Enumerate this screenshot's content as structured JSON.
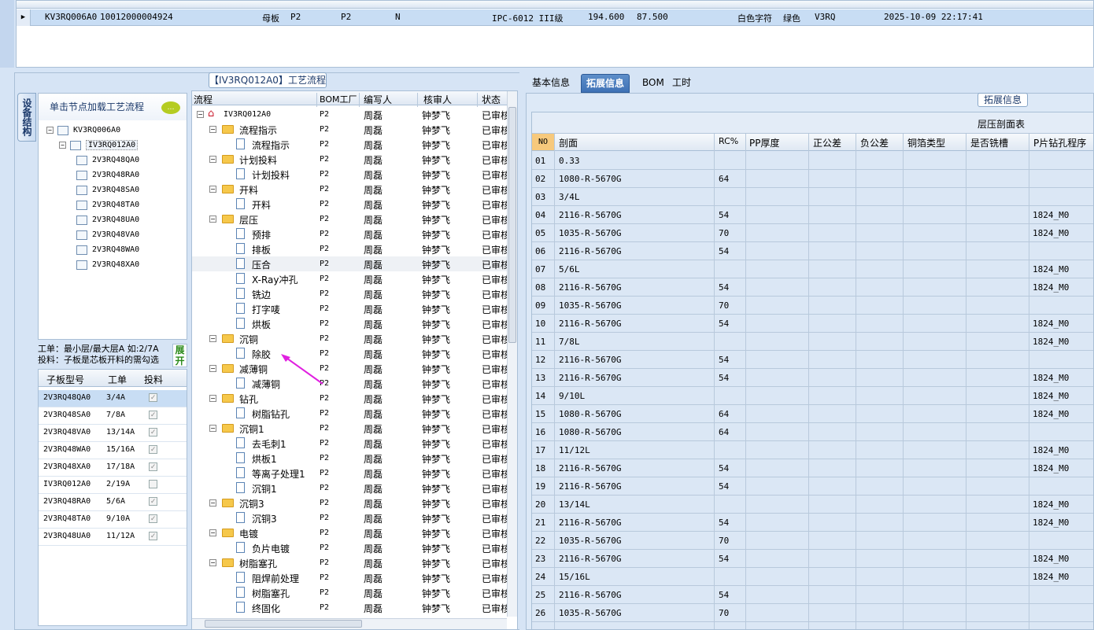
{
  "top_grid": {
    "row": [
      "KV3RQ006A0",
      "10012000004924",
      "母板",
      "P2",
      "P2",
      "N",
      "IPC-6012 III级",
      "194.600",
      "87.500",
      "白色字符",
      "绿色",
      "V3RQ",
      "2025-10-09 22:17:41"
    ]
  },
  "left_panel": {
    "title": "【IV3RQ012A0】工艺流程",
    "side_tab": "设备结构",
    "tree_hint": "单击节点加载工艺流程",
    "tree": {
      "root": "KV3RQ006A0",
      "child": "IV3RQ012A0",
      "leaves": [
        "2V3RQ48QA0",
        "2V3RQ48RA0",
        "2V3RQ48SA0",
        "2V3RQ48TA0",
        "2V3RQ48UA0",
        "2V3RQ48VA0",
        "2V3RQ48WA0",
        "2V3RQ48XA0"
      ]
    },
    "work_info_1": "工单：最小层/最大层A 如:2/7A",
    "work_info_2": "投料：子板是芯板开料的需勾选",
    "expand_label": "展开",
    "sub_grid": {
      "headers": [
        "子板型号",
        "工单",
        "投料"
      ],
      "rows": [
        {
          "model": "2V3RQ48QA0",
          "order": "3/4A",
          "checked": true
        },
        {
          "model": "2V3RQ48SA0",
          "order": "7/8A",
          "checked": true
        },
        {
          "model": "2V3RQ48VA0",
          "order": "13/14A",
          "checked": true
        },
        {
          "model": "2V3RQ48WA0",
          "order": "15/16A",
          "checked": true
        },
        {
          "model": "2V3RQ48XA0",
          "order": "17/18A",
          "checked": true
        },
        {
          "model": "IV3RQ012A0",
          "order": "2/19A",
          "checked": false
        },
        {
          "model": "2V3RQ48RA0",
          "order": "5/6A",
          "checked": true
        },
        {
          "model": "2V3RQ48TA0",
          "order": "9/10A",
          "checked": true
        },
        {
          "model": "2V3RQ48UA0",
          "order": "11/12A",
          "checked": true
        }
      ]
    }
  },
  "process_tree": {
    "headers": [
      "流程",
      "BOM工厂",
      "编写人",
      "核审人",
      "状态"
    ],
    "root": "IV3RQ012A0",
    "bom": "P2",
    "writer": "周磊",
    "reviewer": "钟梦飞",
    "status": "已审核",
    "rows": [
      {
        "label": "流程指示",
        "type": "folder"
      },
      {
        "label": "流程指示",
        "type": "doc"
      },
      {
        "label": "计划投料",
        "type": "folder"
      },
      {
        "label": "计划投料",
        "type": "doc"
      },
      {
        "label": "开料",
        "type": "folder"
      },
      {
        "label": "开料",
        "type": "doc"
      },
      {
        "label": "层压",
        "type": "folder"
      },
      {
        "label": "预排",
        "type": "doc"
      },
      {
        "label": "排板",
        "type": "doc"
      },
      {
        "label": "压合",
        "type": "doc"
      },
      {
        "label": "X-Ray冲孔",
        "type": "doc"
      },
      {
        "label": "铣边",
        "type": "doc"
      },
      {
        "label": "打字唛",
        "type": "doc"
      },
      {
        "label": "烘板",
        "type": "doc"
      },
      {
        "label": "沉铜",
        "type": "folder"
      },
      {
        "label": "除胶",
        "type": "doc"
      },
      {
        "label": "减薄铜",
        "type": "folder"
      },
      {
        "label": "减薄铜",
        "type": "doc"
      },
      {
        "label": "钻孔",
        "type": "folder"
      },
      {
        "label": "树脂钻孔",
        "type": "doc"
      },
      {
        "label": "沉铜1",
        "type": "folder"
      },
      {
        "label": "去毛刺1",
        "type": "doc"
      },
      {
        "label": "烘板1",
        "type": "doc"
      },
      {
        "label": "等离子处理1",
        "type": "doc"
      },
      {
        "label": "沉铜1",
        "type": "doc"
      },
      {
        "label": "沉铜3",
        "type": "folder"
      },
      {
        "label": "沉铜3",
        "type": "doc"
      },
      {
        "label": "电镀",
        "type": "folder"
      },
      {
        "label": "负片电镀",
        "type": "doc"
      },
      {
        "label": "树脂塞孔",
        "type": "folder"
      },
      {
        "label": "阻焊前处理",
        "type": "doc"
      },
      {
        "label": "树脂塞孔",
        "type": "doc"
      },
      {
        "label": "终固化",
        "type": "doc"
      }
    ]
  },
  "right_panel": {
    "tabs": [
      "基本信息",
      "拓展信息",
      "BOM",
      "工时"
    ],
    "group_title": "拓展信息",
    "grid_caption": "层压剖面表",
    "headers": [
      "NO",
      "剖面",
      "RC%",
      "PP厚度",
      "正公差",
      "负公差",
      "铜箔类型",
      "是否铣槽",
      "P片钻孔程序"
    ],
    "rows": [
      [
        "01",
        "0.33",
        "",
        ""
      ],
      [
        "02",
        "1080-R-5670G",
        "64",
        ""
      ],
      [
        "03",
        "3/4L",
        "",
        ""
      ],
      [
        "04",
        "2116-R-5670G",
        "54",
        "1824_M0"
      ],
      [
        "05",
        "1035-R-5670G",
        "70",
        "1824_M0"
      ],
      [
        "06",
        "2116-R-5670G",
        "54",
        ""
      ],
      [
        "07",
        "5/6L",
        "",
        "1824_M0"
      ],
      [
        "08",
        "2116-R-5670G",
        "54",
        "1824_M0"
      ],
      [
        "09",
        "1035-R-5670G",
        "70",
        ""
      ],
      [
        "10",
        "2116-R-5670G",
        "54",
        "1824_M0"
      ],
      [
        "11",
        "7/8L",
        "",
        "1824_M0"
      ],
      [
        "12",
        "2116-R-5670G",
        "54",
        ""
      ],
      [
        "13",
        "2116-R-5670G",
        "54",
        "1824_M0"
      ],
      [
        "14",
        "9/10L",
        "",
        "1824_M0"
      ],
      [
        "15",
        "1080-R-5670G",
        "64",
        "1824_M0"
      ],
      [
        "16",
        "1080-R-5670G",
        "64",
        ""
      ],
      [
        "17",
        "11/12L",
        "",
        "1824_M0"
      ],
      [
        "18",
        "2116-R-5670G",
        "54",
        "1824_M0"
      ],
      [
        "19",
        "2116-R-5670G",
        "54",
        ""
      ],
      [
        "20",
        "13/14L",
        "",
        "1824_M0"
      ],
      [
        "21",
        "2116-R-5670G",
        "54",
        "1824_M0"
      ],
      [
        "22",
        "1035-R-5670G",
        "70",
        ""
      ],
      [
        "23",
        "2116-R-5670G",
        "54",
        "1824_M0"
      ],
      [
        "24",
        "15/16L",
        "",
        "1824_M0"
      ],
      [
        "25",
        "2116-R-5670G",
        "54",
        ""
      ],
      [
        "26",
        "1035-R-5670G",
        "70",
        ""
      ]
    ]
  }
}
